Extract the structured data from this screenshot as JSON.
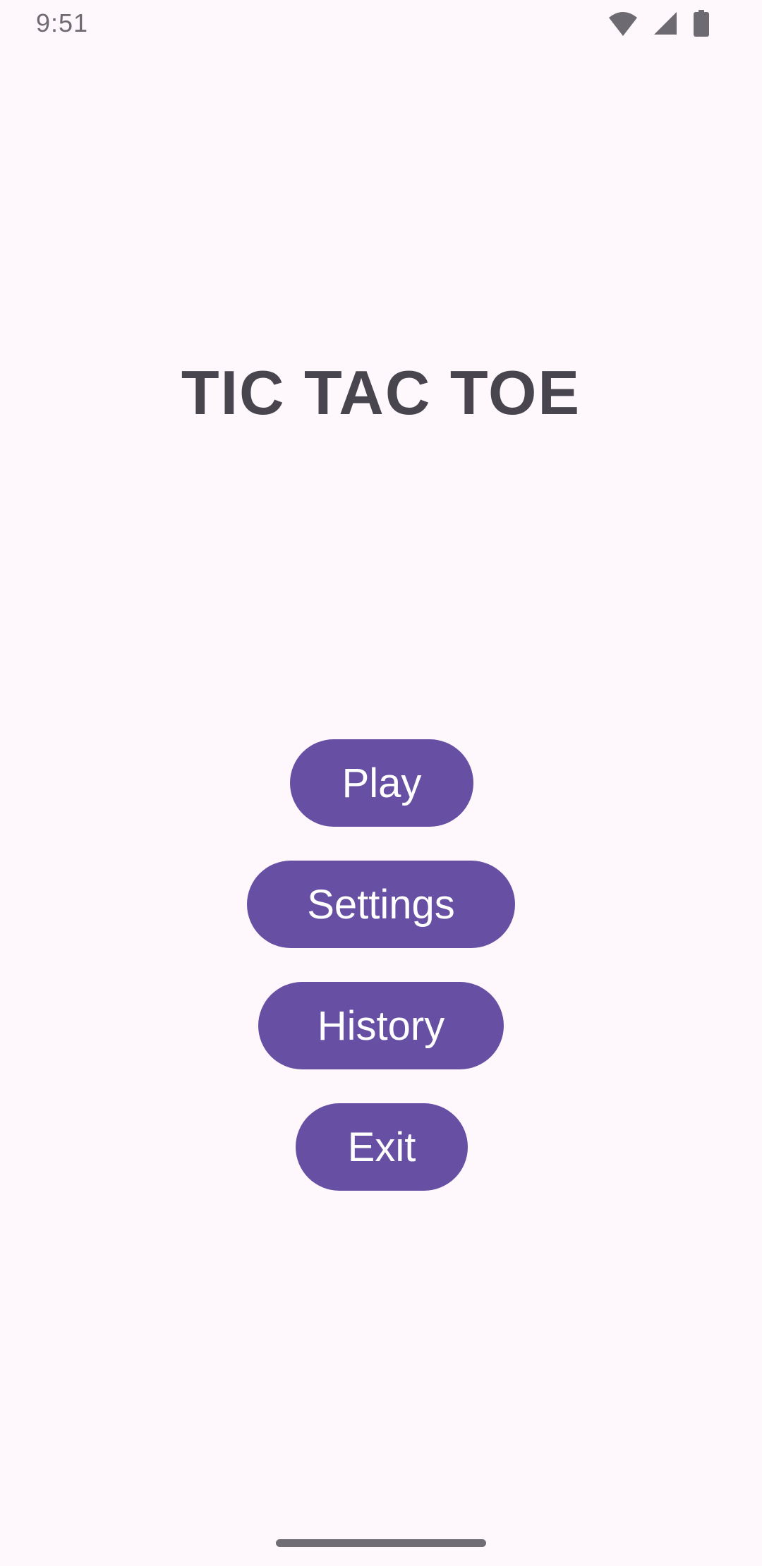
{
  "status_bar": {
    "time": "9:51",
    "icons": [
      "wifi-icon",
      "signal-icon",
      "battery-icon"
    ],
    "icon_color": "#6e6a72"
  },
  "main": {
    "title": "TIC TAC TOE",
    "buttons": [
      {
        "label": "Play"
      },
      {
        "label": "Settings"
      },
      {
        "label": "History"
      },
      {
        "label": "Exit"
      }
    ]
  },
  "colors": {
    "background": "#fef7fb",
    "accent": "#6750a4",
    "title_text": "#48454f",
    "button_text": "#ffffff"
  }
}
